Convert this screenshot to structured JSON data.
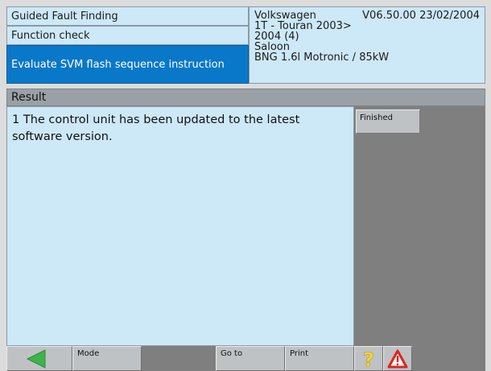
{
  "header": {
    "left": {
      "line1": "Guided Fault Finding",
      "line2": "Function check",
      "line3": "Evaluate SVM flash sequence instruction"
    },
    "right": {
      "brand": "Volkswagen",
      "version": "V06.50.00 23/02/2004",
      "model": "1T - Touran 2003>",
      "year": "2004 (4)",
      "body": "Saloon",
      "engine": "BNG 1.6l Motronic / 85kW"
    }
  },
  "result": {
    "label": "Result"
  },
  "main": {
    "text": "1 The control unit has been updated to the latest software version."
  },
  "side": {
    "finished_label": "Finished"
  },
  "toolbar": {
    "mode_label": "Mode",
    "goto_label": "Go to",
    "print_label": "Print"
  },
  "colors": {
    "panel": "#cde8f7",
    "selected": "#0a78c8",
    "back_arrow": "#3db44a",
    "help": "#f2d53c",
    "warning": "#e0241b"
  },
  "icons": {
    "back": "back-arrow-icon",
    "help": "help-question-icon",
    "warning": "warning-triangle-icon"
  }
}
